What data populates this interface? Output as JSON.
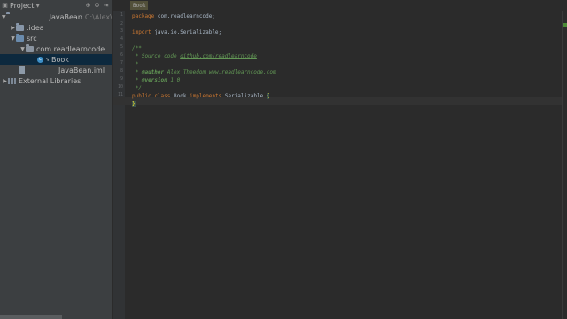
{
  "project_panel": {
    "title": "Project",
    "tree": [
      {
        "label": "JavaBean",
        "path": "C:\\Alex\\"
      },
      {
        "label": ".idea"
      },
      {
        "label": "src"
      },
      {
        "label": "com.readlearncode"
      },
      {
        "label": "Book"
      },
      {
        "label": "JavaBean.iml"
      },
      {
        "label": "External Libraries"
      }
    ]
  },
  "editor": {
    "tab": "Book",
    "line_numbers": [
      "1",
      "2",
      "3",
      "4",
      "5",
      "6",
      "7",
      "8",
      "9",
      "10",
      "11",
      "12"
    ],
    "lines": {
      "l1_kw": "package",
      "l1_rest": " com.readlearncode;",
      "l3_kw": "import",
      "l3_rest": " java.io.Serializable;",
      "l5": "/**",
      "l6_a": " * Source code ",
      "l6_link": "github.com/readlearncode",
      "l7": " *",
      "l8_tag": "@author",
      "l8_rest": " Alex Theedom www.readlearncode.com",
      "l9_tag": "@version",
      "l9_rest": " 1.0",
      "l10": " */",
      "l11_kw1": "public",
      "l11_kw2": "class",
      "l11_name": "Book",
      "l11_kw3": "implements",
      "l11_iface": "Serializable",
      "l11_brace": "{",
      "l12_brace": "}"
    }
  }
}
